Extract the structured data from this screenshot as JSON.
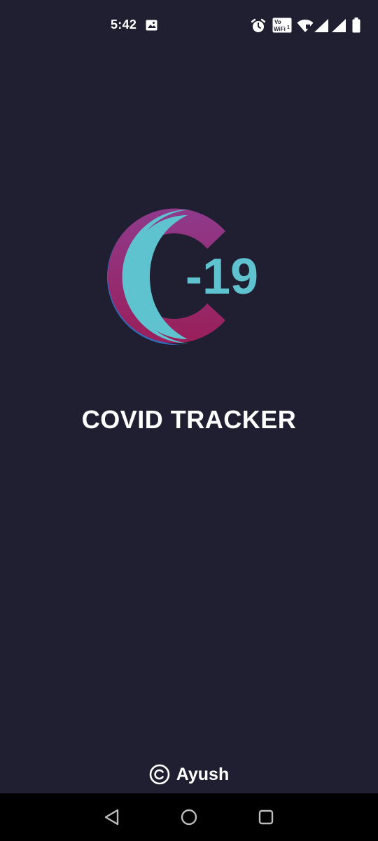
{
  "status_bar": {
    "time": "5:42",
    "icons": [
      "image-icon",
      "alarm-icon",
      "vowifi-icon",
      "wifi-icon",
      "signal-icon",
      "signal-icon-2",
      "battery-icon"
    ]
  },
  "splash": {
    "logo_text": "-19",
    "title": "COVID TRACKER",
    "logo_colors": {
      "blue": "#2f6bb8",
      "magenta": "#9a2a6e",
      "purple": "#8f3a8c",
      "cyan": "#5ec3cf"
    }
  },
  "footer": {
    "credit_symbol": "copyright-icon",
    "credit_name": "Ayush"
  },
  "nav_bar": {
    "buttons": [
      "back-icon",
      "home-icon",
      "recents-icon"
    ]
  },
  "colors": {
    "background": "#201f32",
    "text": "#ffffff",
    "nav_background": "#000000"
  }
}
